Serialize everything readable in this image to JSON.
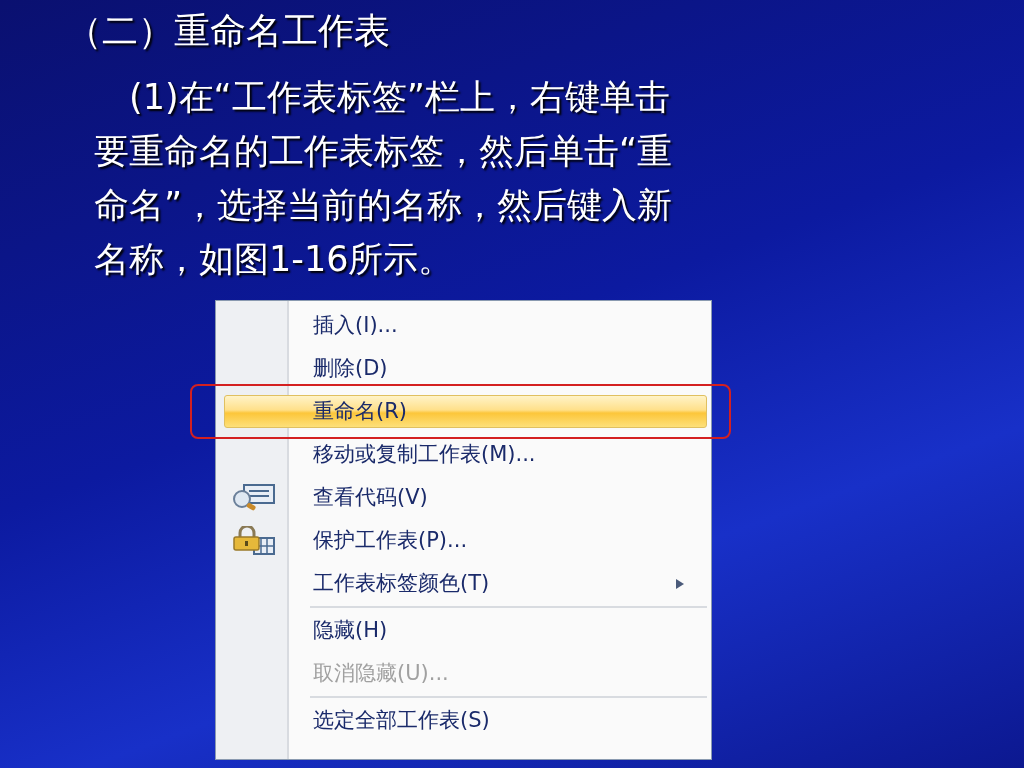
{
  "slide": {
    "title": "（二）重命名工作表",
    "body": "(1)在“工作表标签”栏上，右键单击要重命名的工作表标签，然后单击“重命名”，选择当前的名称，然后键入新名称，如图1-16所示。"
  },
  "menu": {
    "items": [
      {
        "kind": "item",
        "label": "插入(I)...",
        "selected": false,
        "disabled": false,
        "submenu": false
      },
      {
        "kind": "item",
        "label": "删除(D)",
        "selected": false,
        "disabled": false,
        "submenu": false
      },
      {
        "kind": "item",
        "label": "重命名(R)",
        "selected": true,
        "disabled": false,
        "submenu": false,
        "annotated": true
      },
      {
        "kind": "item",
        "label": "移动或复制工作表(M)...",
        "selected": false,
        "disabled": false,
        "submenu": false
      },
      {
        "kind": "item",
        "label": "查看代码(V)",
        "selected": false,
        "disabled": false,
        "submenu": false
      },
      {
        "kind": "item",
        "label": "保护工作表(P)...",
        "selected": false,
        "disabled": false,
        "submenu": false
      },
      {
        "kind": "item",
        "label": "工作表标签颜色(T)",
        "selected": false,
        "disabled": false,
        "submenu": true
      },
      {
        "kind": "separator"
      },
      {
        "kind": "item",
        "label": "隐藏(H)",
        "selected": false,
        "disabled": false,
        "submenu": false
      },
      {
        "kind": "item",
        "label": "取消隐藏(U)...",
        "selected": false,
        "disabled": true,
        "submenu": false
      },
      {
        "kind": "separator"
      },
      {
        "kind": "item",
        "label": "选定全部工作表(S)",
        "selected": false,
        "disabled": false,
        "submenu": false
      }
    ]
  }
}
